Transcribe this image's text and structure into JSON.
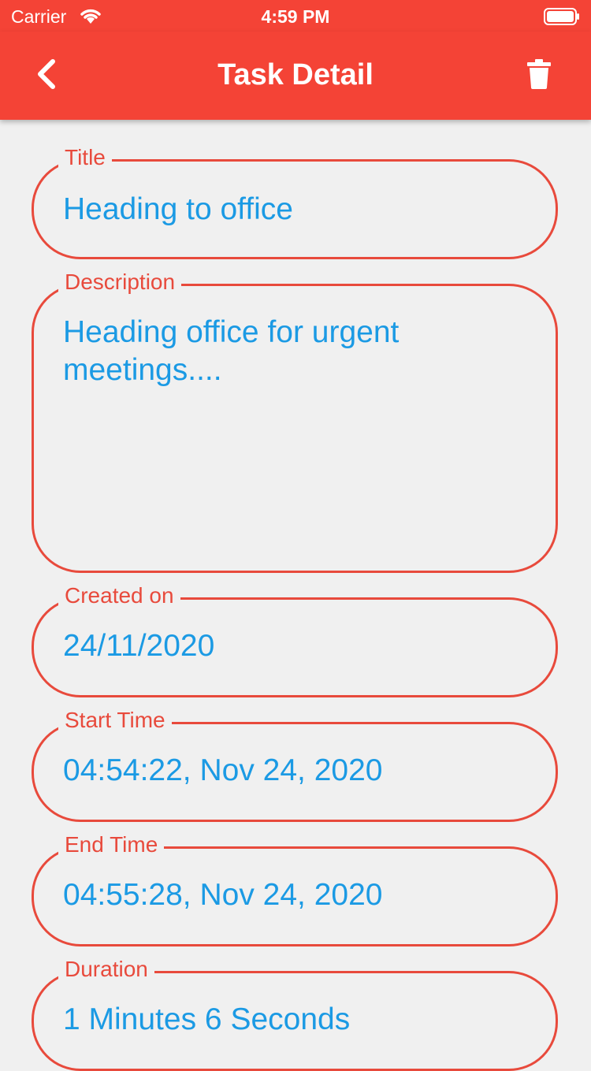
{
  "status_bar": {
    "carrier": "Carrier",
    "time": "4:59 PM"
  },
  "app_bar": {
    "title": "Task Detail",
    "back_icon": "chevron-left-icon",
    "delete_icon": "trash-icon"
  },
  "fields": {
    "title": {
      "label": "Title",
      "value": "Heading to office"
    },
    "description": {
      "label": "Description",
      "value": "Heading office for urgent meetings...."
    },
    "created_on": {
      "label": "Created on",
      "value": "24/11/2020"
    },
    "start_time": {
      "label": "Start Time",
      "value": "04:54:22, Nov 24, 2020"
    },
    "end_time": {
      "label": "End Time",
      "value": "04:55:28, Nov 24, 2020"
    },
    "duration": {
      "label": "Duration",
      "value": "1 Minutes 6 Seconds"
    }
  },
  "colors": {
    "accent": "#f44336",
    "field_border": "#e84a3c",
    "value_text": "#1b9ae4",
    "background": "#f0f0f0"
  }
}
